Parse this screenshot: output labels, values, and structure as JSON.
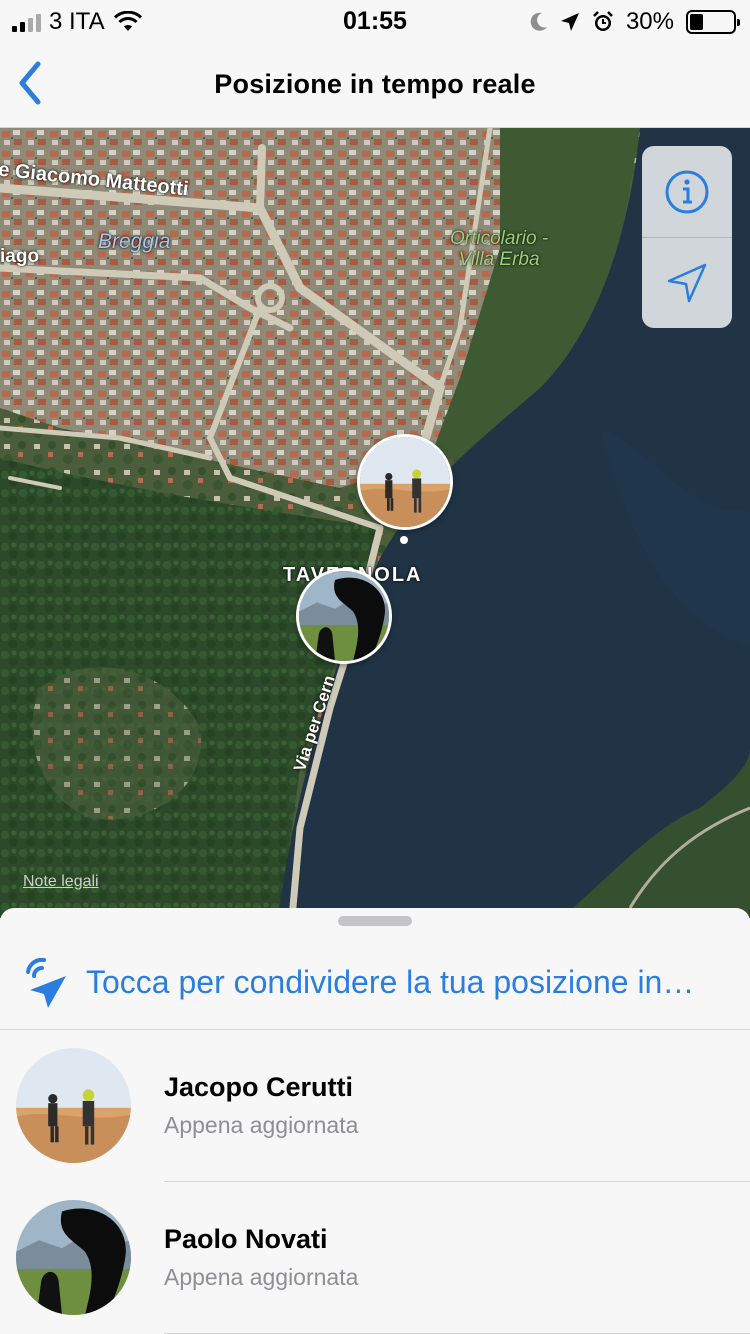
{
  "status_bar": {
    "carrier": "3 ITA",
    "time": "01:55",
    "battery": "30%",
    "battery_level": 0.3,
    "icons": [
      "signal-icon",
      "wifi-icon",
      "moon-icon",
      "location-arrow-icon",
      "alarm-icon",
      "battery-icon"
    ]
  },
  "nav": {
    "back_icon": "chevron-left-icon",
    "title": "Posizione in tempo reale"
  },
  "map": {
    "labels": {
      "street_matteotti": "le Giacomo Matteotti",
      "river_breggia": "Breggia",
      "street_iago": "iago",
      "park": "Orticolario -\nVilla Erba",
      "town": "TAVERNOLA",
      "road_cernobbio": "Via per Cern"
    },
    "legal": "Note legali",
    "controls": [
      "info-icon",
      "location-arrow-icon"
    ]
  },
  "sheet": {
    "share_text": "Tocca per condividere la tua posizione in…",
    "people": [
      {
        "name": "Jacopo Cerutti",
        "status": "Appena aggiornata"
      },
      {
        "name": "Paolo Novati",
        "status": "Appena aggiornata"
      }
    ]
  },
  "colors": {
    "accent": "#2b7de0",
    "lake": "#203446",
    "forest": "#2d4a2b",
    "secondary_text": "#8e8e93"
  }
}
